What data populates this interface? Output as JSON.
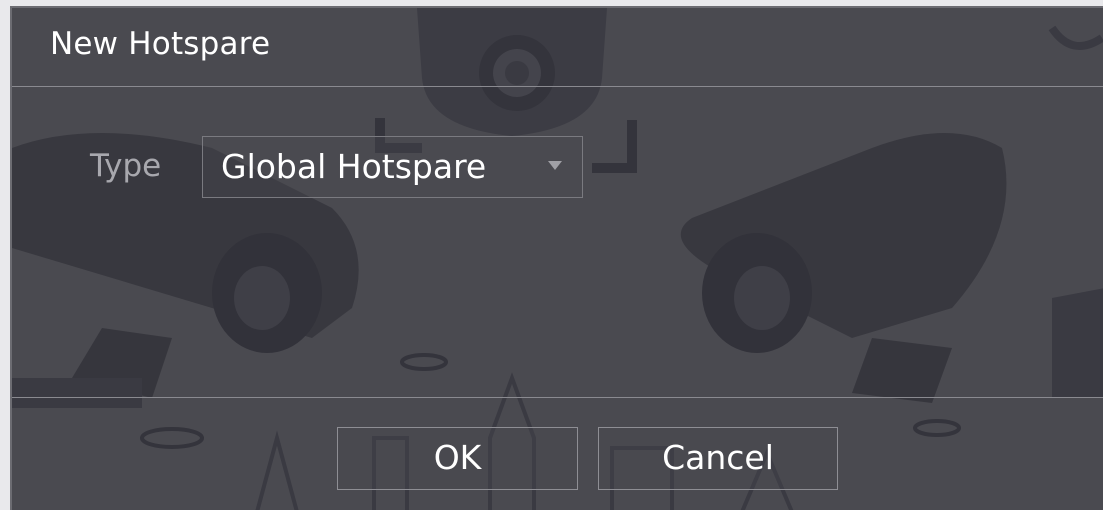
{
  "dialog": {
    "title": "New Hotspare"
  },
  "form": {
    "type_label": "Type",
    "type_value": "Global Hotspare"
  },
  "buttons": {
    "ok_label": "OK",
    "cancel_label": "Cancel"
  },
  "colors": {
    "dialog_background": "#4a4a50",
    "illustration": "#3a3a42",
    "text_primary": "#ffffff",
    "text_label": "#a8a8ae",
    "border": "#8a8a90"
  }
}
